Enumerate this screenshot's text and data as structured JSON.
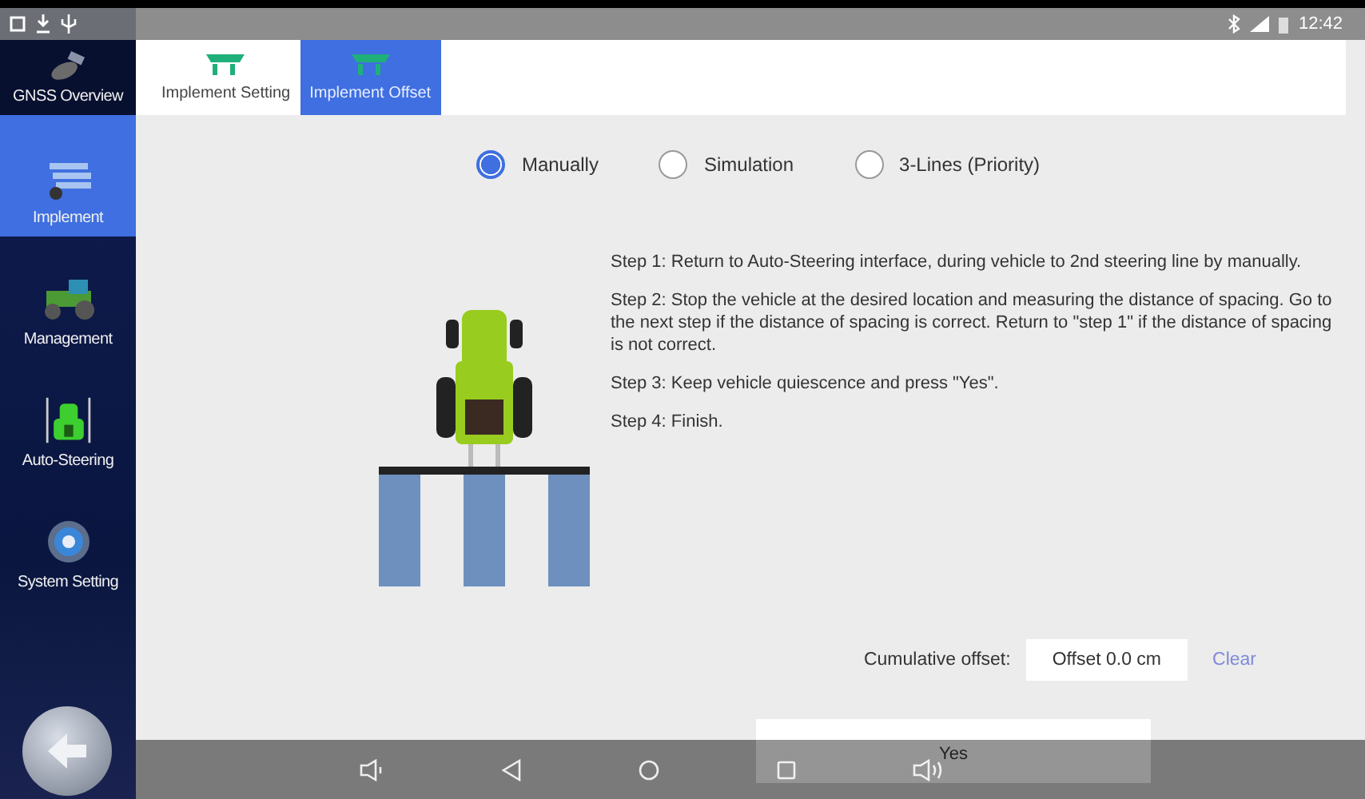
{
  "status_bar": {
    "time": "12:42"
  },
  "sidebar": {
    "items": [
      {
        "label": "GNSS Overview",
        "kind": "satellite",
        "selected": false
      },
      {
        "label": "Implement",
        "kind": "implement",
        "selected": true
      },
      {
        "label": "Management",
        "kind": "tractor",
        "selected": false
      },
      {
        "label": "Auto-Steering",
        "kind": "steering",
        "selected": false
      },
      {
        "label": "System Setting",
        "kind": "gear",
        "selected": false
      }
    ]
  },
  "tabs": [
    {
      "label": "Implement Setting",
      "selected": false
    },
    {
      "label": "Implement Offset",
      "selected": true
    }
  ],
  "modes": [
    {
      "label": "Manually",
      "selected": true
    },
    {
      "label": "Simulation",
      "selected": false
    },
    {
      "label": "3-Lines (Priority)",
      "selected": false
    }
  ],
  "steps": [
    "Step 1: Return to Auto-Steering interface, during vehicle to 2nd steering line by manually.",
    "Step 2: Stop the vehicle at the desired location and measuring the distance of spacing. Go to the next step if the distance of spacing is correct. Return to \"step 1\" if the distance of spacing is not correct.",
    "Step 3: Keep vehicle quiescence and press \"Yes\".",
    "Step 4: Finish."
  ],
  "offset": {
    "label": "Cumulative offset:",
    "value": "Offset 0.0 cm",
    "clear": "Clear"
  },
  "confirm_button": "Yes"
}
